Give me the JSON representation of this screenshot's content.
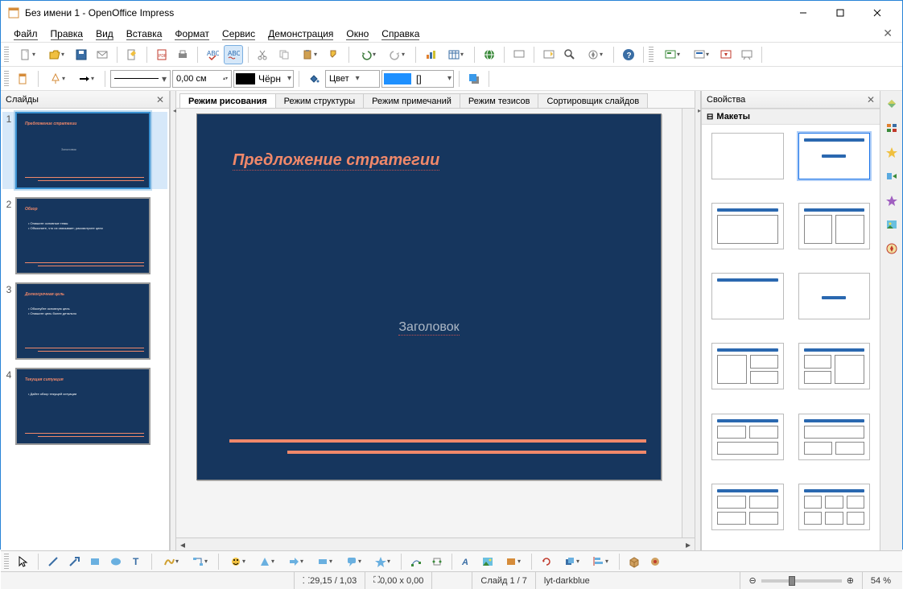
{
  "title": "Без имени 1 - OpenOffice Impress",
  "menu": {
    "file": "Файл",
    "edit": "Правка",
    "view": "Вид",
    "insert": "Вставка",
    "format": "Формат",
    "tools": "Сервис",
    "demo": "Демонстрация",
    "window": "Окно",
    "help": "Справка"
  },
  "toolbar2": {
    "line_width": "0,00 см",
    "line_color_label": "Чёрн",
    "fill_label": "Цвет",
    "fill_pattern": "[]"
  },
  "panels": {
    "slides_title": "Слайды",
    "props_title": "Свойства",
    "layouts_title": "Макеты"
  },
  "tabs": {
    "drawing": "Режим рисования",
    "outline": "Режим структуры",
    "notes": "Режим примечаний",
    "handout": "Режим тезисов",
    "sorter": "Сортировщик слайдов"
  },
  "canvas": {
    "title": "Предложение стратегии",
    "subtitle": "Заголовок"
  },
  "thumbs": {
    "s1_title": "Предложение стратегии",
    "s1_sub": "Заголовок",
    "s2_title": "Обзор",
    "s2_body": "• Опишите основные темы<br>• Объясните, что их связывает; рассмотрите цели",
    "s3_title": "Долгосрочная цель",
    "s3_body": "• Обоснуйте основную цель<br>• Опишите цель более детально",
    "s4_title": "Текущая ситуация",
    "s4_body": "• Дайте обзор текущей ситуации"
  },
  "status": {
    "coords": "29,15 / 1,03",
    "size": "0,00 x 0,00",
    "slide": "Слайд 1 / 7",
    "layout": "lyt-darkblue",
    "zoom": "54 %"
  }
}
